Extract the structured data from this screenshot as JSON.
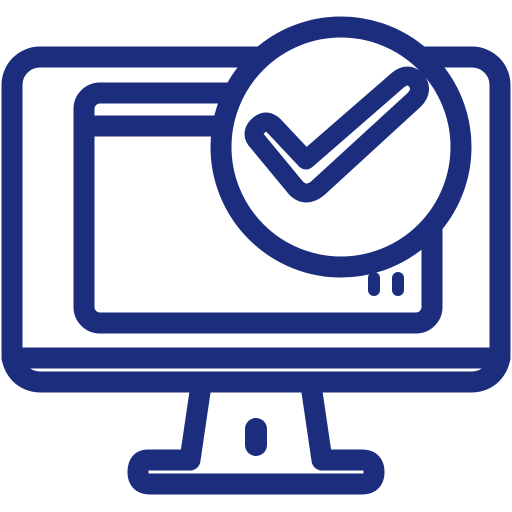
{
  "icon": {
    "name": "computer-monitor-checkmark-icon",
    "stroke_color": "#1d2d7e",
    "background_color": "#ffffff",
    "parts": [
      "monitor-frame",
      "browser-window",
      "check-badge",
      "checkmark",
      "monitor-stand"
    ]
  }
}
